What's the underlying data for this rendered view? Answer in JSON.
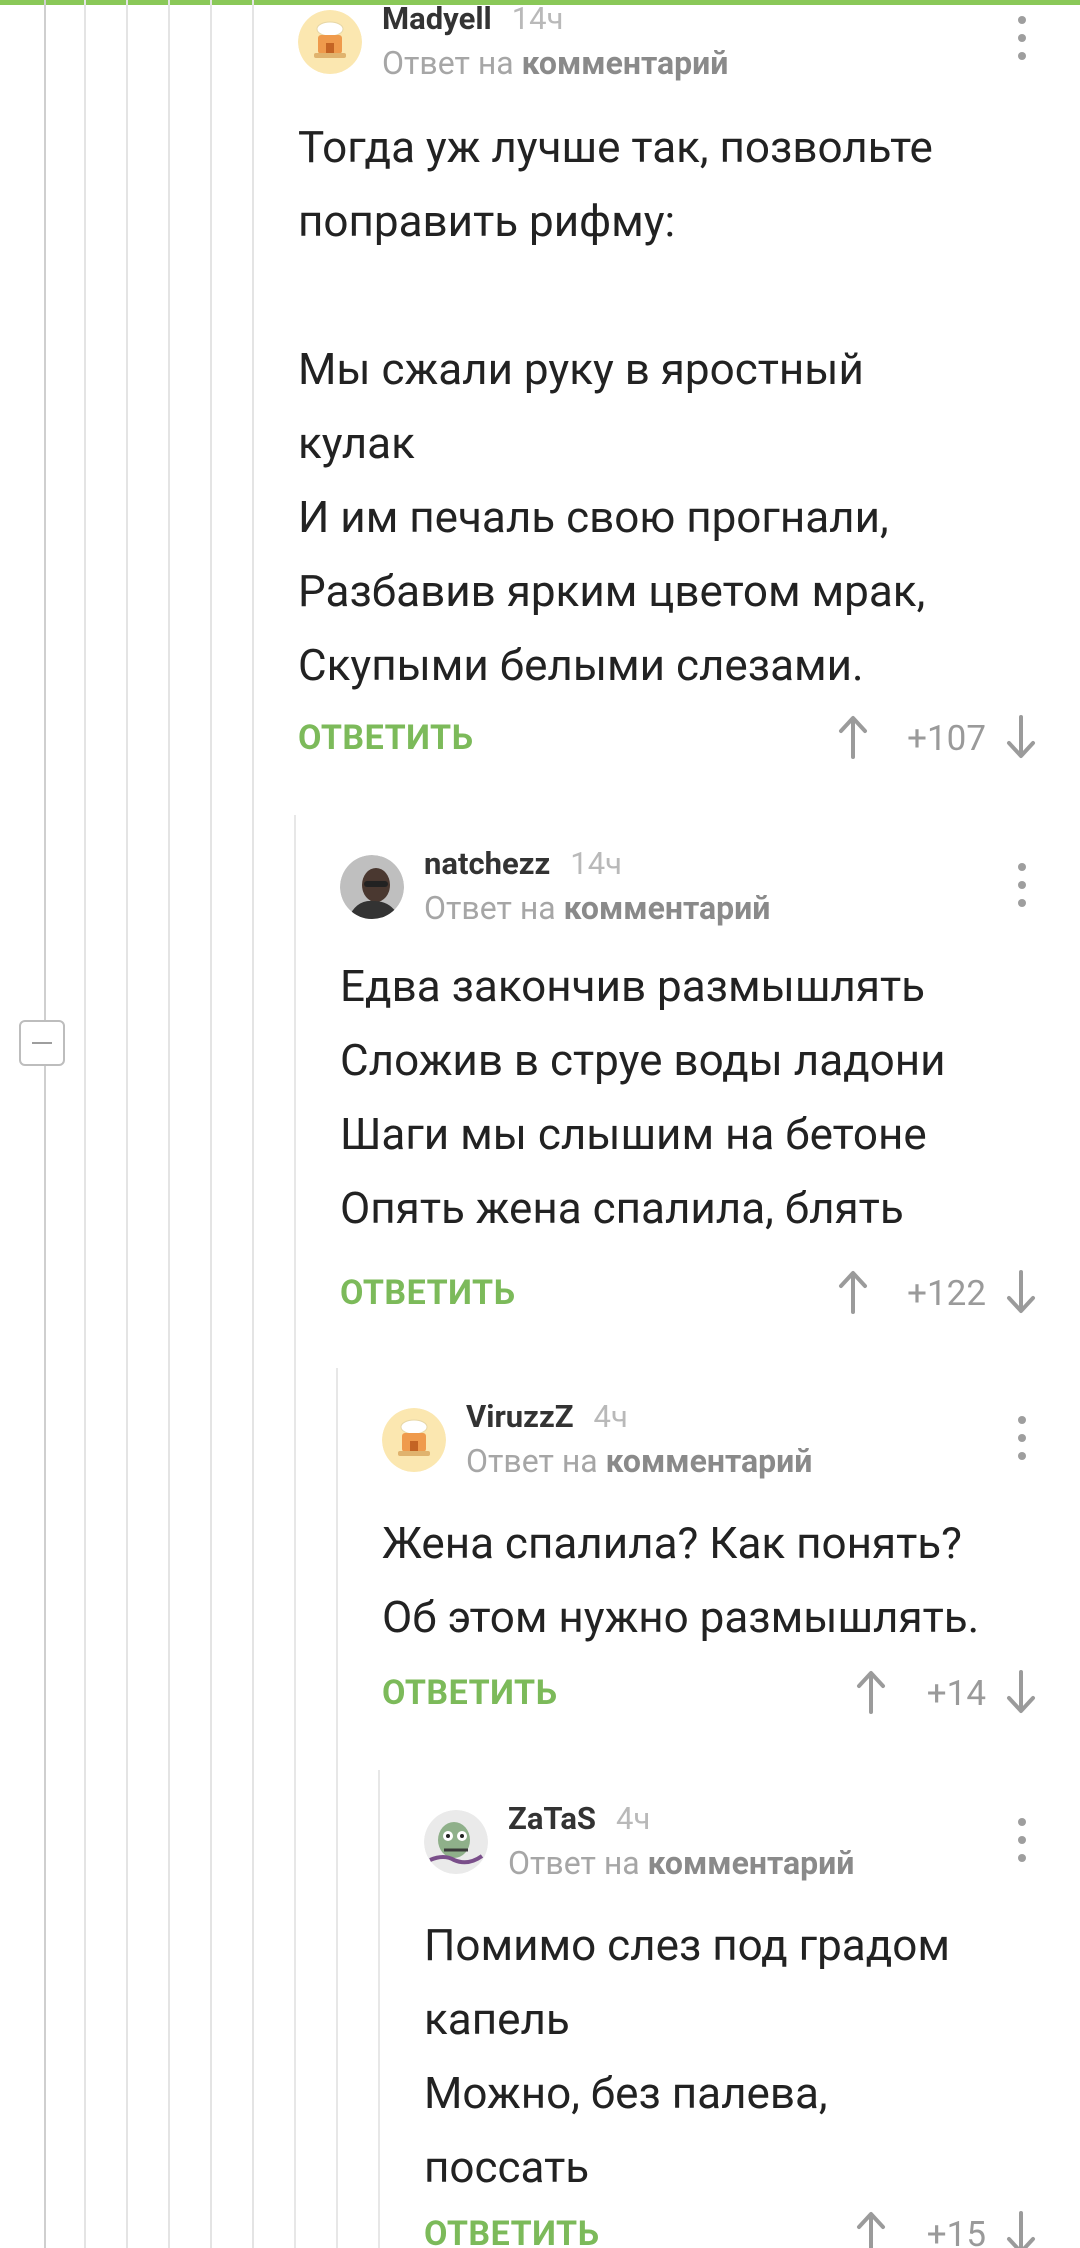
{
  "colors": {
    "accent": "#7cba5a",
    "top_bar": "#8ac858",
    "muted_text": "#a6a6a6",
    "thread_line": "#e4e4e4"
  },
  "icons": [
    "chef-avatar",
    "photo-avatar",
    "zombie-avatar",
    "kebab-menu-icon",
    "arrow-up-icon",
    "arrow-down-icon",
    "collapse-icon"
  ],
  "reply_prefix": "Ответ на",
  "reply_target": "комментарий",
  "reply_button_label": "ОТВЕТИТЬ",
  "comments": [
    {
      "author": "Madyell",
      "time": "14ч",
      "avatar_icon": "chef-avatar",
      "body": "Тогда уж лучше так, позвольте\nпоправить рифму:\n\nМы сжали руку в яростный\nкулак\nИ им печаль свою прогнали,\nРазбавив ярким цветом мрак,\nСкупыми белыми слезами.",
      "rating": "+107"
    },
    {
      "author": "natchezz",
      "time": "14ч",
      "avatar_icon": "photo-avatar",
      "body": "Едва закончив размышлять\nСложив в струе воды ладони\nШаги мы слышим на бетоне\nОпять жена спалила, блять",
      "rating": "+122"
    },
    {
      "author": "ViruzzZ",
      "time": "4ч",
      "avatar_icon": "chef-avatar",
      "body": "Жена спалила? Как понять?\nОб этом нужно размышлять.",
      "rating": "+14"
    },
    {
      "author": "ZaTaS",
      "time": "4ч",
      "avatar_icon": "zombie-avatar",
      "body": "Помимо слез под градом\nкапель\nМожно, без палева,\nпоссать",
      "rating": "+15"
    }
  ]
}
